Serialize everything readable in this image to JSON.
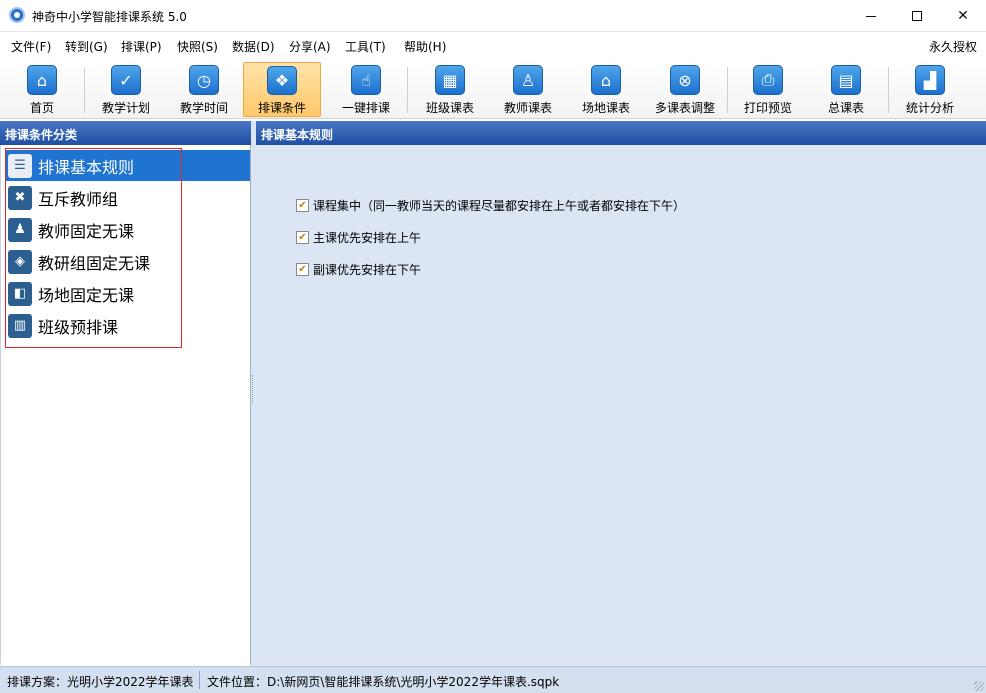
{
  "window": {
    "title": "神奇中小学智能排课系统 5.0",
    "minimize": "—",
    "maximize": "☐",
    "close": "✕"
  },
  "menu": {
    "items": [
      "文件(F)",
      "转到(G)",
      "排课(P)",
      "快照(S)",
      "数据(D)",
      "分享(A)",
      "工具(T)",
      "帮助(H)"
    ],
    "license": "永久授权"
  },
  "toolbar": {
    "items": [
      {
        "label": "首页",
        "icon": "home-icon",
        "glyph": "⌂"
      },
      {
        "label": "教学计划",
        "icon": "clipboard-check-icon",
        "glyph": "✓"
      },
      {
        "label": "教学时间",
        "icon": "clock-icon",
        "glyph": "◷"
      },
      {
        "label": "排课条件",
        "icon": "cubes-icon",
        "glyph": "❖",
        "active": true
      },
      {
        "label": "一键排课",
        "icon": "hand-pointer-icon",
        "glyph": "☝"
      },
      {
        "label": "班级课表",
        "icon": "calendar-icon",
        "glyph": "▦"
      },
      {
        "label": "教师课表",
        "icon": "teacher-card-icon",
        "glyph": "♙"
      },
      {
        "label": "场地课表",
        "icon": "building-icon",
        "glyph": "⌂"
      },
      {
        "label": "多课表调整",
        "icon": "table-adjust-icon",
        "glyph": "⊗"
      },
      {
        "label": "打印预览",
        "icon": "printer-icon",
        "glyph": "⎙"
      },
      {
        "label": "总课表",
        "icon": "grid-calendar-icon",
        "glyph": "▤"
      },
      {
        "label": "统计分析",
        "icon": "bar-chart-icon",
        "glyph": "▟"
      }
    ]
  },
  "left_panel": {
    "header": "排课条件分类",
    "items": [
      {
        "label": "排课基本规则",
        "icon": "clipboard-list-icon",
        "glyph": "☰",
        "selected": true
      },
      {
        "label": "互斥教师组",
        "icon": "teacher-exclude-icon",
        "glyph": "✖"
      },
      {
        "label": "教师固定无课",
        "icon": "teacher-desk-icon",
        "glyph": "♟"
      },
      {
        "label": "教研组固定无课",
        "icon": "cube-icon",
        "glyph": "◈"
      },
      {
        "label": "场地固定无课",
        "icon": "floorplan-icon",
        "glyph": "◧"
      },
      {
        "label": "班级预排课",
        "icon": "book-icon",
        "glyph": "▥"
      }
    ]
  },
  "right_panel": {
    "header": "排课基本规则",
    "rules": [
      {
        "label": "课程集中（同一教师当天的课程尽量都安排在上午或者都安排在下午）",
        "checked": true
      },
      {
        "label": "主课优先安排在上午",
        "checked": true
      },
      {
        "label": "副课优先安排在下午",
        "checked": true
      }
    ],
    "check_glyph": "✔"
  },
  "status": {
    "plan": "排课方案：光明小学2022学年课表",
    "file": "文件位置：D:\\新网页\\智能排课系统\\光明小学2022学年课表.sqpk"
  }
}
